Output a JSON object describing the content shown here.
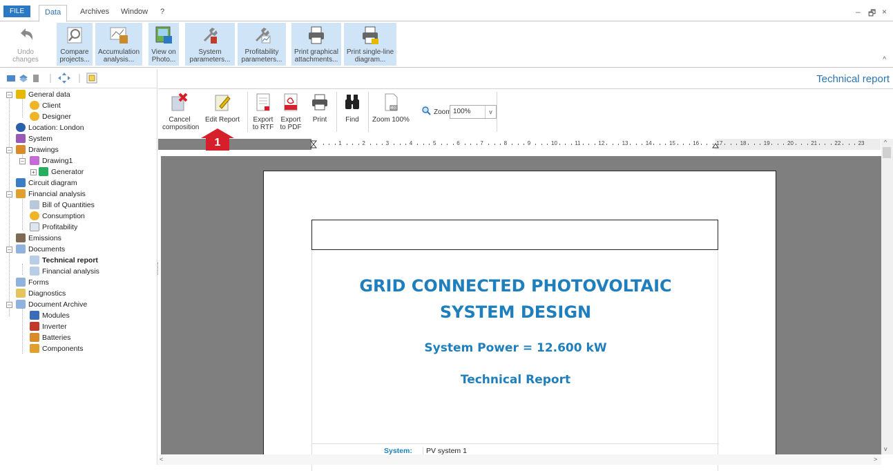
{
  "menu": {
    "file": "FILE",
    "data": "Data",
    "archives": "Archives",
    "window": "Window",
    "help": "?"
  },
  "window_controls": {
    "minimize": "–",
    "restore": "🗗",
    "close": "×"
  },
  "ribbon": {
    "undo": "Undo changes",
    "compare": [
      "Compare",
      "projects..."
    ],
    "accumulation": [
      "Accumulation",
      "analysis..."
    ],
    "view_photo": [
      "View on",
      "Photo..."
    ],
    "system_params": [
      "System",
      "parameters..."
    ],
    "profit_params": [
      "Profitability",
      "parameters..."
    ],
    "print_graphical": [
      "Print graphical",
      "attachments..."
    ],
    "print_single": [
      "Print single-line",
      "diagram..."
    ],
    "collapse": "^"
  },
  "tree": {
    "items": [
      {
        "label": "General data"
      },
      {
        "label": "Client"
      },
      {
        "label": "Designer"
      },
      {
        "label": "Location: London"
      },
      {
        "label": "System"
      },
      {
        "label": "Drawings"
      },
      {
        "label": "Drawing1"
      },
      {
        "label": "Generator"
      },
      {
        "label": "Circuit diagram"
      },
      {
        "label": "Financial analysis"
      },
      {
        "label": "Bill of Quantities"
      },
      {
        "label": "Consumption"
      },
      {
        "label": "Profitability"
      },
      {
        "label": "Emissions"
      },
      {
        "label": "Documents"
      },
      {
        "label": "Technical report"
      },
      {
        "label": "Financial analysis"
      },
      {
        "label": "Forms"
      },
      {
        "label": "Diagnostics"
      },
      {
        "label": "Document Archive"
      },
      {
        "label": "Modules"
      },
      {
        "label": "Inverter"
      },
      {
        "label": "Batteries"
      },
      {
        "label": "Components"
      }
    ]
  },
  "panel": {
    "title": "Technical report"
  },
  "report_toolbar": {
    "cancel": [
      "Cancel",
      "composition"
    ],
    "edit": "Edit Report",
    "export_rtf": [
      "Export",
      "to RTF"
    ],
    "export_pdf": [
      "Export",
      "to PDF"
    ],
    "print": "Print",
    "find": "Find",
    "zoom100": "Zoom 100%",
    "zoom_label": "Zoom",
    "zoom_value": "100%"
  },
  "ruler": {
    "numbers": [
      "1",
      "2",
      "3",
      "4",
      "5",
      "6",
      "7",
      "8",
      "9",
      "10",
      "11",
      "12",
      "13",
      "14",
      "15",
      "16",
      "17",
      "18",
      "19",
      "20",
      "21",
      "22",
      "23"
    ]
  },
  "document": {
    "title_line1": "GRID CONNECTED PHOTOVOLTAIC",
    "title_line2": "SYSTEM  DESIGN",
    "power": "System Power = 12.600 kW",
    "subtitle": "Technical Report",
    "system_label": "System:",
    "system_value": "PV system 1"
  },
  "annotation": {
    "step": "1"
  },
  "colors": {
    "accent": "#2b78c5",
    "doc_title": "#1f7fbd",
    "callout": "#d51f2a",
    "selection": "#cfe4f6"
  }
}
